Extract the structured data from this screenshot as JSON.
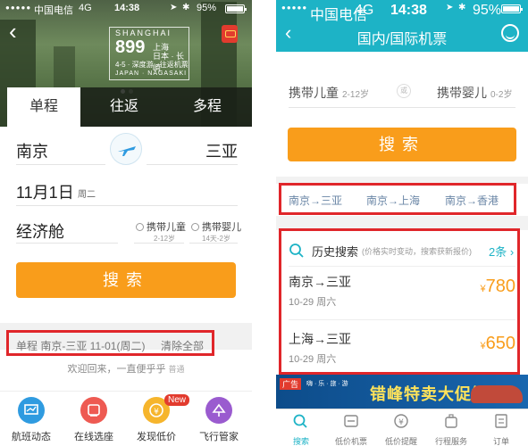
{
  "status_left": {
    "carrier": "中国电信",
    "network": "4G",
    "time": "14:38",
    "battery": "95%"
  },
  "status_right": {
    "carrier": "中国电信",
    "network": "4G",
    "time": "14:38",
    "battery": "95%"
  },
  "left": {
    "banner": {
      "line1": "SHANGHAI",
      "price": "899",
      "price_suffix": "起",
      "dest1": "上海",
      "dest2": "日本 · 长崎",
      "line4": "4-5 · 深度游 · 往返机票",
      "line5": "JAPAN · NAGASAKI",
      "side": "NAGASAKI"
    },
    "tabs": [
      "单程",
      "往返",
      "多程"
    ],
    "from_city": "南京",
    "to_city": "三亚",
    "date": "11月1日",
    "weekday": "周二",
    "cabin": "经济舱",
    "child": {
      "label": "携带儿童",
      "age": "2-12岁"
    },
    "infant": {
      "label": "携带婴儿",
      "age": "14天-2岁"
    },
    "search_label": "搜索",
    "history_text": "单程 南京-三亚 11-01(周二)",
    "clear_label": "清除全部",
    "welcome": "欢迎回来，一直便乎乎",
    "welcome_tag": "普通",
    "bottom_items": [
      {
        "label": "航班动态",
        "color": "#2f9be0"
      },
      {
        "label": "在线选座",
        "color": "#ee5a52"
      },
      {
        "label": "发现低价",
        "color": "#f6b52c"
      },
      {
        "label": "飞行管家",
        "color": "#9a5bcf"
      }
    ],
    "new_badge": "New"
  },
  "right": {
    "title": "国内/国际机票",
    "child": {
      "label": "携带儿童",
      "age": "2-12岁"
    },
    "infant": {
      "label": "携带婴儿",
      "age": "0-2岁"
    },
    "sep": "或",
    "search_label": "搜索",
    "routes": [
      "南京→三亚",
      "南京→上海",
      "南京→香港"
    ],
    "history": {
      "title": "历史搜索",
      "note": "(价格实时变动，搜索获新报价)",
      "count": "2条",
      "items": [
        {
          "route": "南京→三亚",
          "date": "10-29 周六",
          "currency": "¥",
          "price": "780"
        },
        {
          "route": "上海→三亚",
          "date": "10-29 周六",
          "currency": "¥",
          "price": "650"
        }
      ]
    },
    "ad": {
      "tag": "广告",
      "sub": "嗨 · 乐 · 旅 · 游",
      "text": "错峰特卖大促销"
    },
    "tabs": [
      "搜索",
      "低价机票",
      "低价提醒",
      "行程服务",
      "订单"
    ]
  },
  "colors": {
    "accent": "#1db3c6",
    "orange": "#f99d1b",
    "highlight": "#e0262a"
  }
}
